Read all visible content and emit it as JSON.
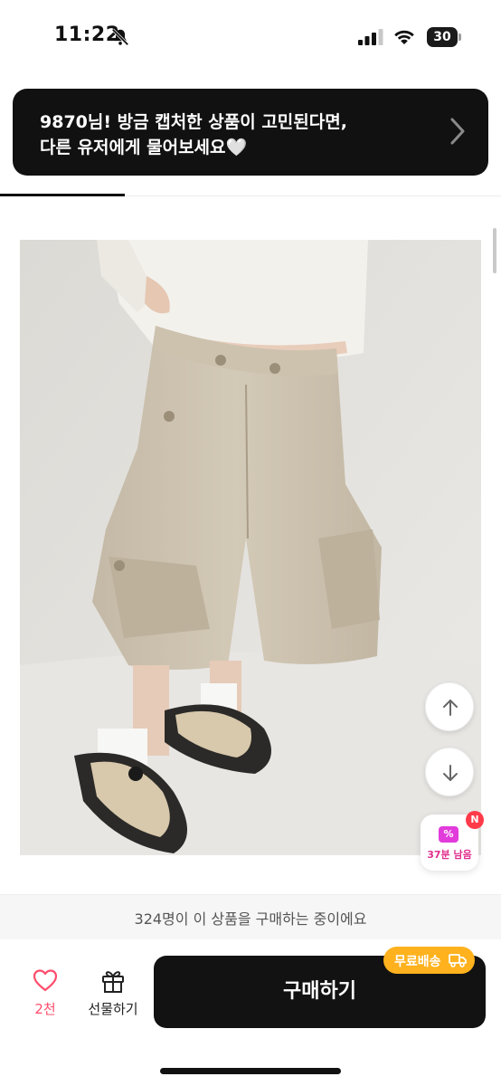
{
  "status_bar": {
    "time": "11:22",
    "battery": "30",
    "icons": [
      "bell-muted-icon",
      "signal-icon",
      "wifi-icon",
      "battery-icon"
    ]
  },
  "toast": {
    "line1": "9870님! 방금 캡처한 상품이 고민된다면,",
    "line2": "다른 유저에게 물어보세요🤍",
    "icon": "chevron-right-icon"
  },
  "product_image": {
    "alt_icon": "product-photo"
  },
  "floating": {
    "up_icon": "arrow-up-icon",
    "down_icon": "arrow-down-icon",
    "coupon_badge": "N",
    "coupon_symbol": "%",
    "coupon_timer": "37분 남음"
  },
  "buyers_text": "324명이 이 상품을 구매하는 중이에요",
  "bottom_bar": {
    "like_count": "2천",
    "gift_label": "선물하기",
    "buy_label": "구매하기",
    "shipping_badge": "무료배송"
  },
  "colors": {
    "accent_pink": "#ff4d6d",
    "shipping_orange": "#ffb21e",
    "coupon_magenta": "#e23bdb",
    "dark": "#121212"
  }
}
